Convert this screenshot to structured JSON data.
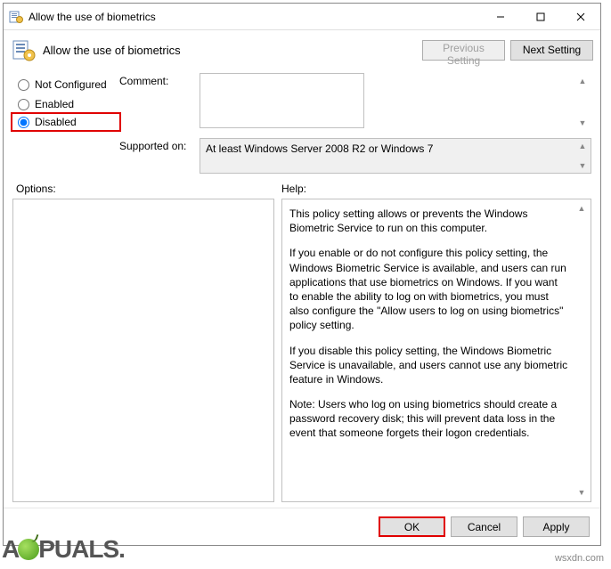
{
  "titlebar": {
    "title": "Allow the use of biometrics"
  },
  "header": {
    "title": "Allow the use of biometrics",
    "prev_label": "Previous Setting",
    "next_label": "Next Setting"
  },
  "radios": {
    "not_configured": "Not Configured",
    "enabled": "Enabled",
    "disabled": "Disabled",
    "selected": "disabled"
  },
  "fields": {
    "comment_label": "Comment:",
    "comment_value": "",
    "supported_label": "Supported on:",
    "supported_value": "At least Windows Server 2008 R2 or Windows 7"
  },
  "labels": {
    "options": "Options:",
    "help": "Help:"
  },
  "help": {
    "p1": "This policy setting allows or prevents the Windows Biometric Service to run on this computer.",
    "p2": "If you enable or do not configure this policy setting, the Windows Biometric Service is available, and users can run applications that use biometrics on Windows. If you want to enable the ability to log on with biometrics, you must also configure the \"Allow users to log on using biometrics\" policy setting.",
    "p3": "If you disable this policy setting, the Windows Biometric Service is unavailable, and users cannot use any biometric feature in Windows.",
    "p4": "Note: Users who log on using biometrics should create a password recovery disk; this will prevent data loss in the event that someone forgets their logon credentials."
  },
  "footer": {
    "ok": "OK",
    "cancel": "Cancel",
    "apply": "Apply"
  },
  "watermark": {
    "left_pre": "A",
    "left_post": "PUALS.",
    "right": "wsxdn.com"
  }
}
